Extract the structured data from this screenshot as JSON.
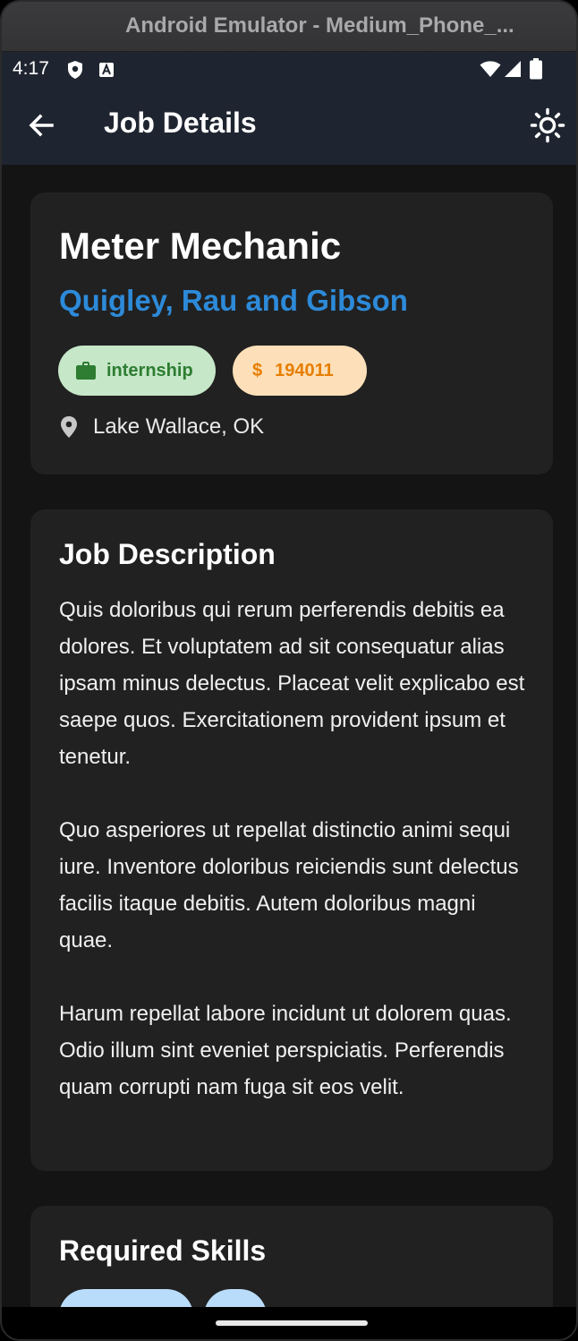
{
  "window": {
    "title": "Android Emulator - Medium_Phone_..."
  },
  "status_bar": {
    "time": "4:17",
    "icons": [
      "shield-icon",
      "a-badge-icon",
      "wifi-icon",
      "signal-icon",
      "battery-icon"
    ]
  },
  "app_bar": {
    "title": "Job Details",
    "back_icon": "arrow-back-icon",
    "theme_icon": "sun-icon"
  },
  "job": {
    "title": "Meter Mechanic",
    "company": "Quigley, Rau and Gibson",
    "type": "internship",
    "salary_symbol": "$",
    "salary": "194011",
    "location": "Lake Wallace, OK"
  },
  "description": {
    "title": "Job Description",
    "text": "Quis doloribus qui rerum perferendis debitis ea dolores. Et voluptatem ad sit consequatur alias ipsam minus delectus. Placeat velit explicabo est saepe quos. Exercitationem provident ipsum et tenetur.\n\nQuo asperiores ut repellat distinctio animi sequi iure. Inventore doloribus reiciendis sunt delectus facilis itaque debitis. Autem doloribus magni quae.\n\nHarum repellat labore incidunt ut dolorem quas. Odio illum sint eveniet perspiciatis. Perferendis quam corrupti nam fuga sit eos velit."
  },
  "skills": {
    "title": "Required Skills"
  },
  "colors": {
    "app_bar": "#1f2530",
    "background": "#141414",
    "card": "#212121",
    "company": "#2d8ad9",
    "chip_type_bg": "#c6e7c8",
    "chip_type_fg": "#2e7d32",
    "chip_salary_bg": "#fde0b9",
    "chip_salary_fg": "#e67e00",
    "skill_chip": "#b9dcfa"
  }
}
